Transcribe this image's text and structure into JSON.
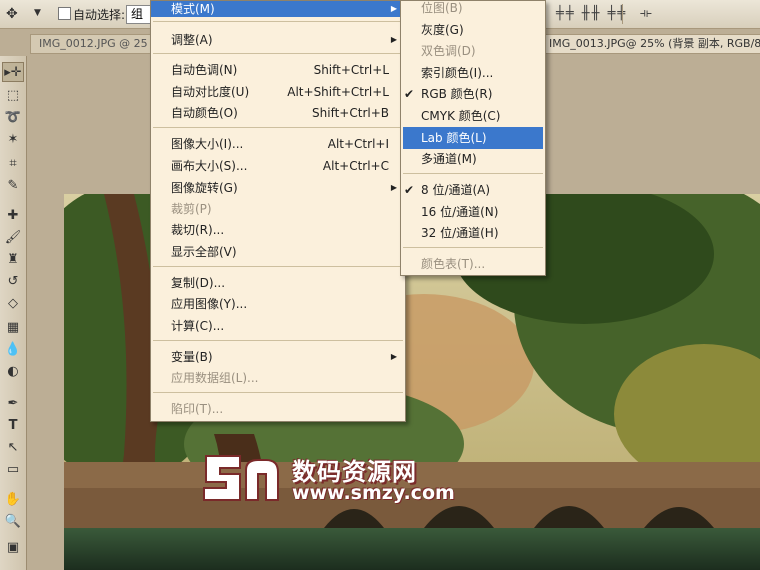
{
  "options_bar": {
    "auto_select_label": "自动选择:",
    "select_value": "组"
  },
  "doc_tabs": [
    "IMG_0012.JPG @ 25",
    "IMG_0013.JPG@ 25% (背景 副本, RGB/8"
  ],
  "mode_menu_header": "模式(M)",
  "image_menu": {
    "items": [
      {
        "label": "调整(A)",
        "shortcut": "",
        "submenu": true,
        "disabled": false
      },
      {
        "label": "自动色调(N)",
        "shortcut": "Shift+Ctrl+L",
        "submenu": false,
        "disabled": false
      },
      {
        "label": "自动对比度(U)",
        "shortcut": "Alt+Shift+Ctrl+L",
        "submenu": false,
        "disabled": false
      },
      {
        "label": "自动颜色(O)",
        "shortcut": "Shift+Ctrl+B",
        "submenu": false,
        "disabled": false
      },
      {
        "label": "图像大小(I)...",
        "shortcut": "Alt+Ctrl+I",
        "submenu": false,
        "disabled": false
      },
      {
        "label": "画布大小(S)...",
        "shortcut": "Alt+Ctrl+C",
        "submenu": false,
        "disabled": false
      },
      {
        "label": "图像旋转(G)",
        "shortcut": "",
        "submenu": true,
        "disabled": false
      },
      {
        "label": "裁剪(P)",
        "shortcut": "",
        "submenu": false,
        "disabled": true
      },
      {
        "label": "裁切(R)...",
        "shortcut": "",
        "submenu": false,
        "disabled": false
      },
      {
        "label": "显示全部(V)",
        "shortcut": "",
        "submenu": false,
        "disabled": false
      },
      {
        "label": "复制(D)...",
        "shortcut": "",
        "submenu": false,
        "disabled": false
      },
      {
        "label": "应用图像(Y)...",
        "shortcut": "",
        "submenu": false,
        "disabled": false
      },
      {
        "label": "计算(C)...",
        "shortcut": "",
        "submenu": false,
        "disabled": false
      },
      {
        "label": "变量(B)",
        "shortcut": "",
        "submenu": true,
        "disabled": false
      },
      {
        "label": "应用数据组(L)...",
        "shortcut": "",
        "submenu": false,
        "disabled": true
      },
      {
        "label": "陷印(T)...",
        "shortcut": "",
        "submenu": false,
        "disabled": true
      }
    ]
  },
  "mode_submenu": {
    "items": [
      {
        "label": "位图(B)",
        "checked": false,
        "disabled": true,
        "highlighted": false
      },
      {
        "label": "灰度(G)",
        "checked": false,
        "disabled": false,
        "highlighted": false
      },
      {
        "label": "双色调(D)",
        "checked": false,
        "disabled": true,
        "highlighted": false
      },
      {
        "label": "索引颜色(I)...",
        "checked": false,
        "disabled": false,
        "highlighted": false
      },
      {
        "label": "RGB 颜色(R)",
        "checked": true,
        "disabled": false,
        "highlighted": false
      },
      {
        "label": "CMYK 颜色(C)",
        "checked": false,
        "disabled": false,
        "highlighted": false
      },
      {
        "label": "Lab 颜色(L)",
        "checked": false,
        "disabled": false,
        "highlighted": true
      },
      {
        "label": "多通道(M)",
        "checked": false,
        "disabled": false,
        "highlighted": false
      },
      {
        "label": "8 位/通道(A)",
        "checked": true,
        "disabled": false,
        "highlighted": false
      },
      {
        "label": "16 位/通道(N)",
        "checked": false,
        "disabled": false,
        "highlighted": false
      },
      {
        "label": "32 位/通道(H)",
        "checked": false,
        "disabled": false,
        "highlighted": false
      },
      {
        "label": "颜色表(T)...",
        "checked": false,
        "disabled": true,
        "highlighted": false
      }
    ]
  },
  "watermark": {
    "title": "数码资源网",
    "url": "www.smzy.com"
  },
  "colors": {
    "highlight": "#3b78cc",
    "menu_bg": "#fbf0dc",
    "disabled": "#9a9080"
  }
}
